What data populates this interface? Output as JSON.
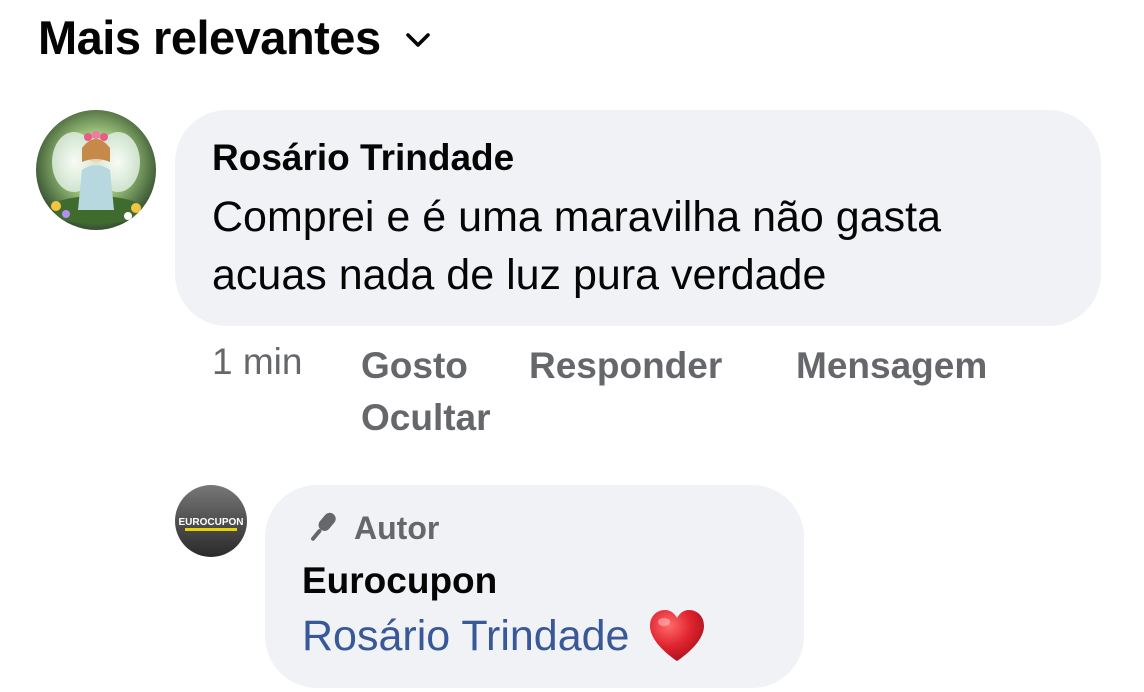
{
  "sort": {
    "label": "Mais relevantes",
    "icon": "chevron-down-icon"
  },
  "comment": {
    "author": "Rosário Trindade",
    "text": "Comprei e é uma maravilha não gasta acuas nada de luz pura verdade",
    "time": "1 min",
    "actions": {
      "like": "Gosto",
      "reply": "Responder",
      "message": "Mensagem",
      "hide": "Ocultar"
    },
    "avatar_icon": "angel-avatar"
  },
  "reply": {
    "badge_icon": "microphone-icon",
    "badge_label": "Autor",
    "author": "Eurocupon",
    "mention": "Rosário Trindade",
    "reaction_icon": "heart-icon",
    "avatar_logo_text": "EUROCUPON"
  },
  "colors": {
    "bubble": "#f0f2f5",
    "secondary_text": "#65676b",
    "mention": "#385898",
    "heart": "#e0242f"
  }
}
